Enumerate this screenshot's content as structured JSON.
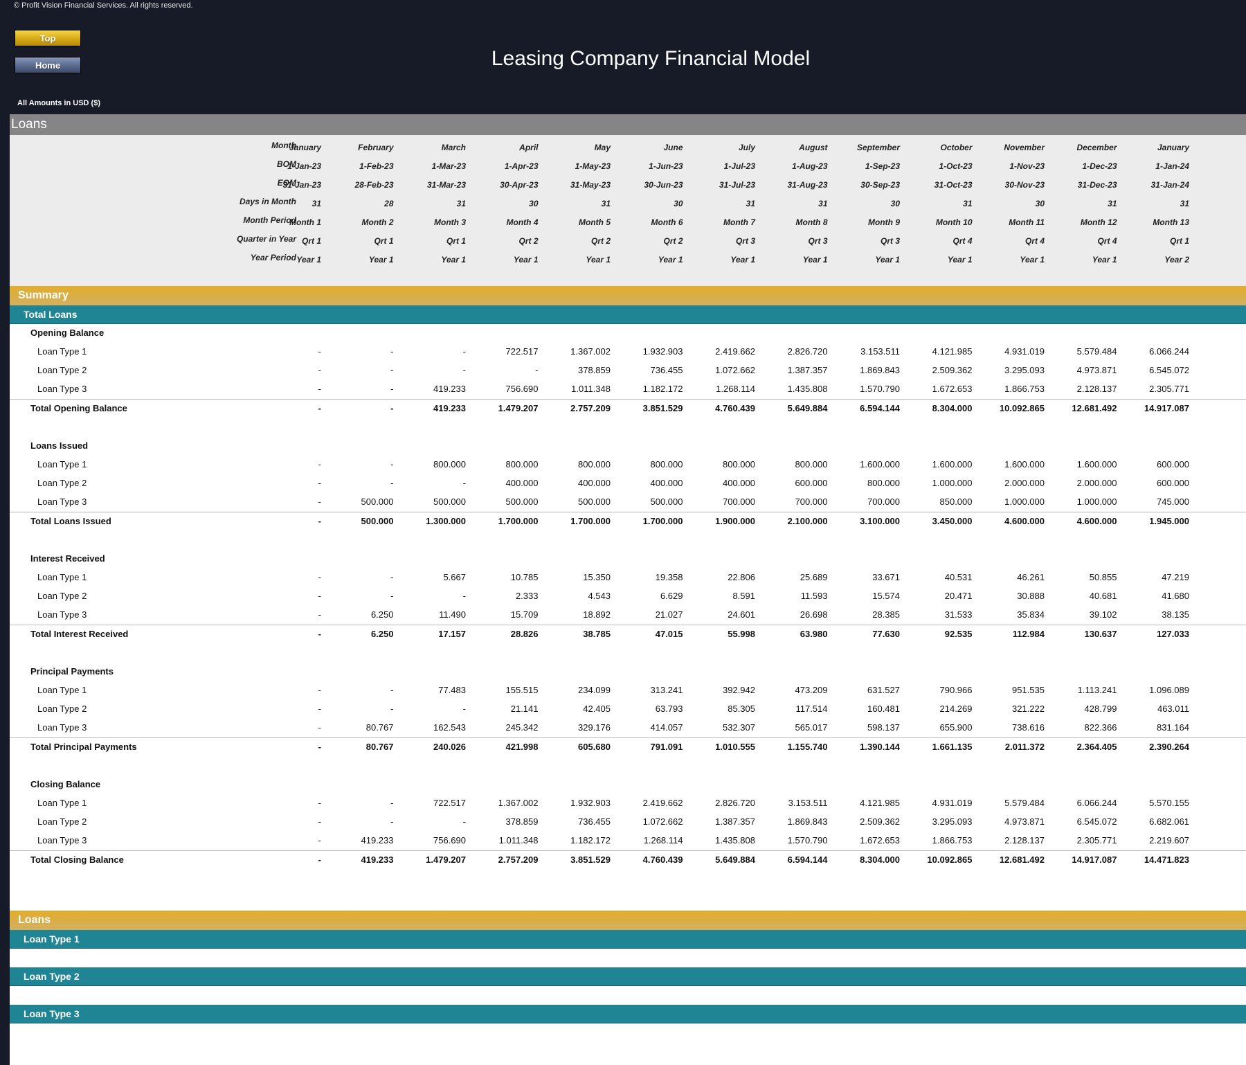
{
  "header": {
    "copyright": "© Profit Vision Financial Services. All rights reserved.",
    "top_button": "Top",
    "home_button": "Home",
    "title": "Leasing Company Financial Model",
    "currency_note": "All Amounts in  USD ($)"
  },
  "section_title": "Loans",
  "timeline": {
    "rows": [
      {
        "label": "Month",
        "values": [
          "January",
          "February",
          "March",
          "April",
          "May",
          "June",
          "July",
          "August",
          "September",
          "October",
          "November",
          "December",
          "January"
        ]
      },
      {
        "label": "BOM",
        "values": [
          "1-Jan-23",
          "1-Feb-23",
          "1-Mar-23",
          "1-Apr-23",
          "1-May-23",
          "1-Jun-23",
          "1-Jul-23",
          "1-Aug-23",
          "1-Sep-23",
          "1-Oct-23",
          "1-Nov-23",
          "1-Dec-23",
          "1-Jan-24"
        ]
      },
      {
        "label": "EOM",
        "values": [
          "31-Jan-23",
          "28-Feb-23",
          "31-Mar-23",
          "30-Apr-23",
          "31-May-23",
          "30-Jun-23",
          "31-Jul-23",
          "31-Aug-23",
          "30-Sep-23",
          "31-Oct-23",
          "30-Nov-23",
          "31-Dec-23",
          "31-Jan-24"
        ]
      },
      {
        "label": "Days in Month",
        "values": [
          "31",
          "28",
          "31",
          "30",
          "31",
          "30",
          "31",
          "31",
          "30",
          "31",
          "30",
          "31",
          "31"
        ]
      },
      {
        "label": "Month Period",
        "values": [
          "Month 1",
          "Month 2",
          "Month 3",
          "Month 4",
          "Month 5",
          "Month 6",
          "Month 7",
          "Month 8",
          "Month 9",
          "Month 10",
          "Month 11",
          "Month 12",
          "Month 13"
        ]
      },
      {
        "label": "Quarter in Year",
        "values": [
          "Qrt 1",
          "Qrt 1",
          "Qrt 1",
          "Qrt 2",
          "Qrt 2",
          "Qrt 2",
          "Qrt 3",
          "Qrt 3",
          "Qrt 3",
          "Qrt 4",
          "Qrt 4",
          "Qrt 4",
          "Qrt 1"
        ]
      },
      {
        "label": "Year Period",
        "values": [
          "Year 1",
          "Year 1",
          "Year 1",
          "Year 1",
          "Year 1",
          "Year 1",
          "Year 1",
          "Year 1",
          "Year 1",
          "Year 1",
          "Year 1",
          "Year 1",
          "Year 2"
        ]
      }
    ]
  },
  "summary": {
    "title": "Summary",
    "subtitle": "Total Loans",
    "groups": [
      {
        "title": "Opening Balance",
        "items": [
          {
            "label": "Loan Type 1",
            "values": [
              "-",
              "-",
              "-",
              "722.517",
              "1.367.002",
              "1.932.903",
              "2.419.662",
              "2.826.720",
              "3.153.511",
              "4.121.985",
              "4.931.019",
              "5.579.484",
              "6.066.244"
            ]
          },
          {
            "label": "Loan Type 2",
            "values": [
              "-",
              "-",
              "-",
              "-",
              "378.859",
              "736.455",
              "1.072.662",
              "1.387.357",
              "1.869.843",
              "2.509.362",
              "3.295.093",
              "4.973.871",
              "6.545.072"
            ]
          },
          {
            "label": "Loan Type 3",
            "values": [
              "-",
              "-",
              "419.233",
              "756.690",
              "1.011.348",
              "1.182.172",
              "1.268.114",
              "1.435.808",
              "1.570.790",
              "1.672.653",
              "1.866.753",
              "2.128.137",
              "2.305.771"
            ]
          }
        ],
        "total": {
          "label": "Total Opening Balance",
          "values": [
            "-",
            "-",
            "419.233",
            "1.479.207",
            "2.757.209",
            "3.851.529",
            "4.760.439",
            "5.649.884",
            "6.594.144",
            "8.304.000",
            "10.092.865",
            "12.681.492",
            "14.917.087"
          ]
        }
      },
      {
        "title": "Loans Issued",
        "items": [
          {
            "label": "Loan Type 1",
            "values": [
              "-",
              "-",
              "800.000",
              "800.000",
              "800.000",
              "800.000",
              "800.000",
              "800.000",
              "1.600.000",
              "1.600.000",
              "1.600.000",
              "1.600.000",
              "600.000"
            ]
          },
          {
            "label": "Loan Type 2",
            "values": [
              "-",
              "-",
              "-",
              "400.000",
              "400.000",
              "400.000",
              "400.000",
              "600.000",
              "800.000",
              "1.000.000",
              "2.000.000",
              "2.000.000",
              "600.000"
            ]
          },
          {
            "label": "Loan Type 3",
            "values": [
              "-",
              "500.000",
              "500.000",
              "500.000",
              "500.000",
              "500.000",
              "700.000",
              "700.000",
              "700.000",
              "850.000",
              "1.000.000",
              "1.000.000",
              "745.000"
            ]
          }
        ],
        "total": {
          "label": "Total Loans Issued",
          "values": [
            "-",
            "500.000",
            "1.300.000",
            "1.700.000",
            "1.700.000",
            "1.700.000",
            "1.900.000",
            "2.100.000",
            "3.100.000",
            "3.450.000",
            "4.600.000",
            "4.600.000",
            "1.945.000"
          ]
        }
      },
      {
        "title": "Interest Received",
        "items": [
          {
            "label": "Loan Type 1",
            "values": [
              "-",
              "-",
              "5.667",
              "10.785",
              "15.350",
              "19.358",
              "22.806",
              "25.689",
              "33.671",
              "40.531",
              "46.261",
              "50.855",
              "47.219"
            ]
          },
          {
            "label": "Loan Type 2",
            "values": [
              "-",
              "-",
              "-",
              "2.333",
              "4.543",
              "6.629",
              "8.591",
              "11.593",
              "15.574",
              "20.471",
              "30.888",
              "40.681",
              "41.680"
            ]
          },
          {
            "label": "Loan Type 3",
            "values": [
              "-",
              "6.250",
              "11.490",
              "15.709",
              "18.892",
              "21.027",
              "24.601",
              "26.698",
              "28.385",
              "31.533",
              "35.834",
              "39.102",
              "38.135"
            ]
          }
        ],
        "total": {
          "label": "Total Interest Received",
          "values": [
            "-",
            "6.250",
            "17.157",
            "28.826",
            "38.785",
            "47.015",
            "55.998",
            "63.980",
            "77.630",
            "92.535",
            "112.984",
            "130.637",
            "127.033"
          ]
        }
      },
      {
        "title": "Principal Payments",
        "items": [
          {
            "label": "Loan Type 1",
            "values": [
              "-",
              "-",
              "77.483",
              "155.515",
              "234.099",
              "313.241",
              "392.942",
              "473.209",
              "631.527",
              "790.966",
              "951.535",
              "1.113.241",
              "1.096.089"
            ]
          },
          {
            "label": "Loan Type 2",
            "values": [
              "-",
              "-",
              "-",
              "21.141",
              "42.405",
              "63.793",
              "85.305",
              "117.514",
              "160.481",
              "214.269",
              "321.222",
              "428.799",
              "463.011"
            ]
          },
          {
            "label": "Loan Type 3",
            "values": [
              "-",
              "80.767",
              "162.543",
              "245.342",
              "329.176",
              "414.057",
              "532.307",
              "565.017",
              "598.137",
              "655.900",
              "738.616",
              "822.366",
              "831.164"
            ]
          }
        ],
        "total": {
          "label": "Total Principal Payments",
          "values": [
            "-",
            "80.767",
            "240.026",
            "421.998",
            "605.680",
            "791.091",
            "1.010.555",
            "1.155.740",
            "1.390.144",
            "1.661.135",
            "2.011.372",
            "2.364.405",
            "2.390.264"
          ]
        }
      },
      {
        "title": "Closing Balance",
        "items": [
          {
            "label": "Loan Type 1",
            "values": [
              "-",
              "-",
              "722.517",
              "1.367.002",
              "1.932.903",
              "2.419.662",
              "2.826.720",
              "3.153.511",
              "4.121.985",
              "4.931.019",
              "5.579.484",
              "6.066.244",
              "5.570.155"
            ]
          },
          {
            "label": "Loan Type 2",
            "values": [
              "-",
              "-",
              "-",
              "378.859",
              "736.455",
              "1.072.662",
              "1.387.357",
              "1.869.843",
              "2.509.362",
              "3.295.093",
              "4.973.871",
              "6.545.072",
              "6.682.061"
            ]
          },
          {
            "label": "Loan Type 3",
            "values": [
              "-",
              "419.233",
              "756.690",
              "1.011.348",
              "1.182.172",
              "1.268.114",
              "1.435.808",
              "1.570.790",
              "1.672.653",
              "1.866.753",
              "2.128.137",
              "2.305.771",
              "2.219.607"
            ]
          }
        ],
        "total": {
          "label": "Total Closing Balance",
          "values": [
            "-",
            "419.233",
            "1.479.207",
            "2.757.209",
            "3.851.529",
            "4.760.439",
            "5.649.884",
            "6.594.144",
            "8.304.000",
            "10.092.865",
            "12.681.492",
            "14.917.087",
            "14.471.823"
          ]
        }
      }
    ]
  },
  "loans_section": {
    "title": "Loans",
    "subsections": [
      "Loan Type 1",
      "Loan Type 2",
      "Loan Type 3"
    ]
  },
  "colors": {
    "background": "#161b27",
    "gray_band": "#858585",
    "gold_band": "#e1ad2c",
    "teal_band": "#1f8595",
    "header_bg": "#ececec"
  }
}
